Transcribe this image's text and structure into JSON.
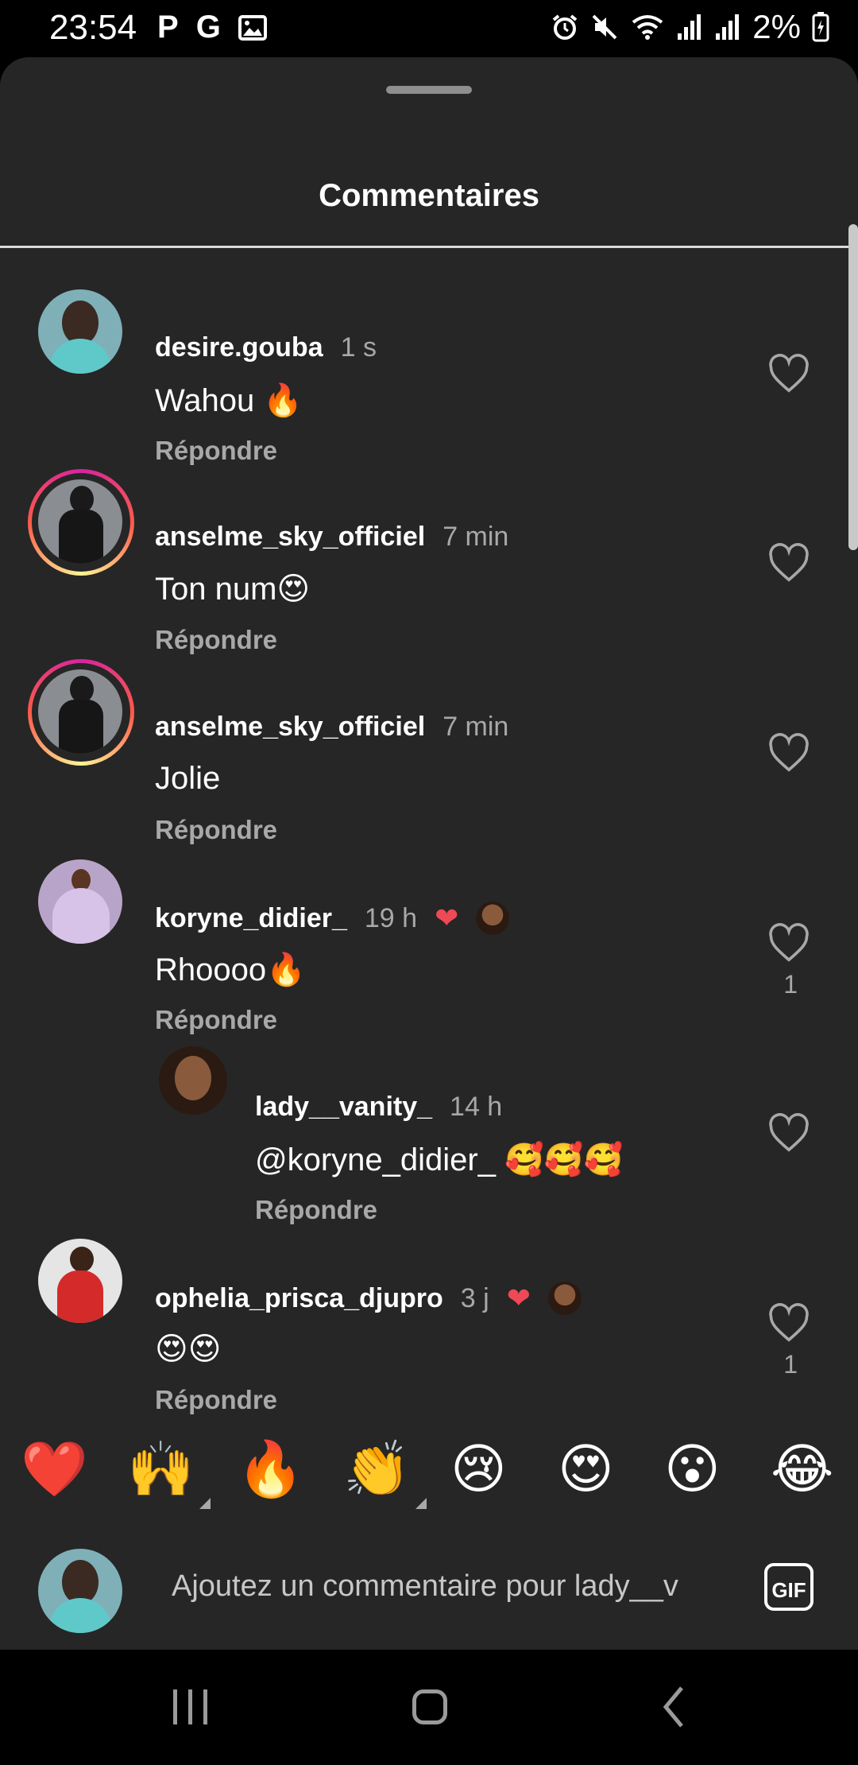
{
  "status_bar": {
    "time": "23:54",
    "left_icons": [
      "P",
      "G"
    ],
    "battery": "2%"
  },
  "sheet": {
    "title": "Commentaires"
  },
  "comments": [
    {
      "user": "desire.gouba",
      "time": "1 s",
      "text": "Wahou 🔥",
      "reply": "Répondre",
      "likes": "",
      "liked_by_author": false
    },
    {
      "user": "anselme_sky_officiel",
      "time": "7 min",
      "text": "Ton num😍",
      "reply": "Répondre",
      "likes": "",
      "liked_by_author": false
    },
    {
      "user": "anselme_sky_officiel",
      "time": "7 min",
      "text": "Jolie",
      "reply": "Répondre",
      "likes": "",
      "liked_by_author": false
    },
    {
      "user": "koryne_didier_",
      "time": "19 h",
      "text": "Rhoooo🔥",
      "reply": "Répondre",
      "likes": "1",
      "liked_by_author": true
    },
    {
      "user": "lady__vanity_",
      "time": "14 h",
      "text": "@koryne_didier_ 🥰🥰🥰",
      "reply": "Répondre",
      "likes": "",
      "liked_by_author": false
    },
    {
      "user": "ophelia_prisca_djupro",
      "time": "3 j",
      "text": "😍😍",
      "reply": "Répondre",
      "likes": "1",
      "liked_by_author": true
    }
  ],
  "emoji_bar": [
    "❤️",
    "🙌",
    "🔥",
    "👏",
    "😢",
    "😍",
    "😮",
    "😂"
  ],
  "composer": {
    "placeholder": "Ajoutez un commentaire pour lady__v",
    "gif_label": "GIF"
  }
}
